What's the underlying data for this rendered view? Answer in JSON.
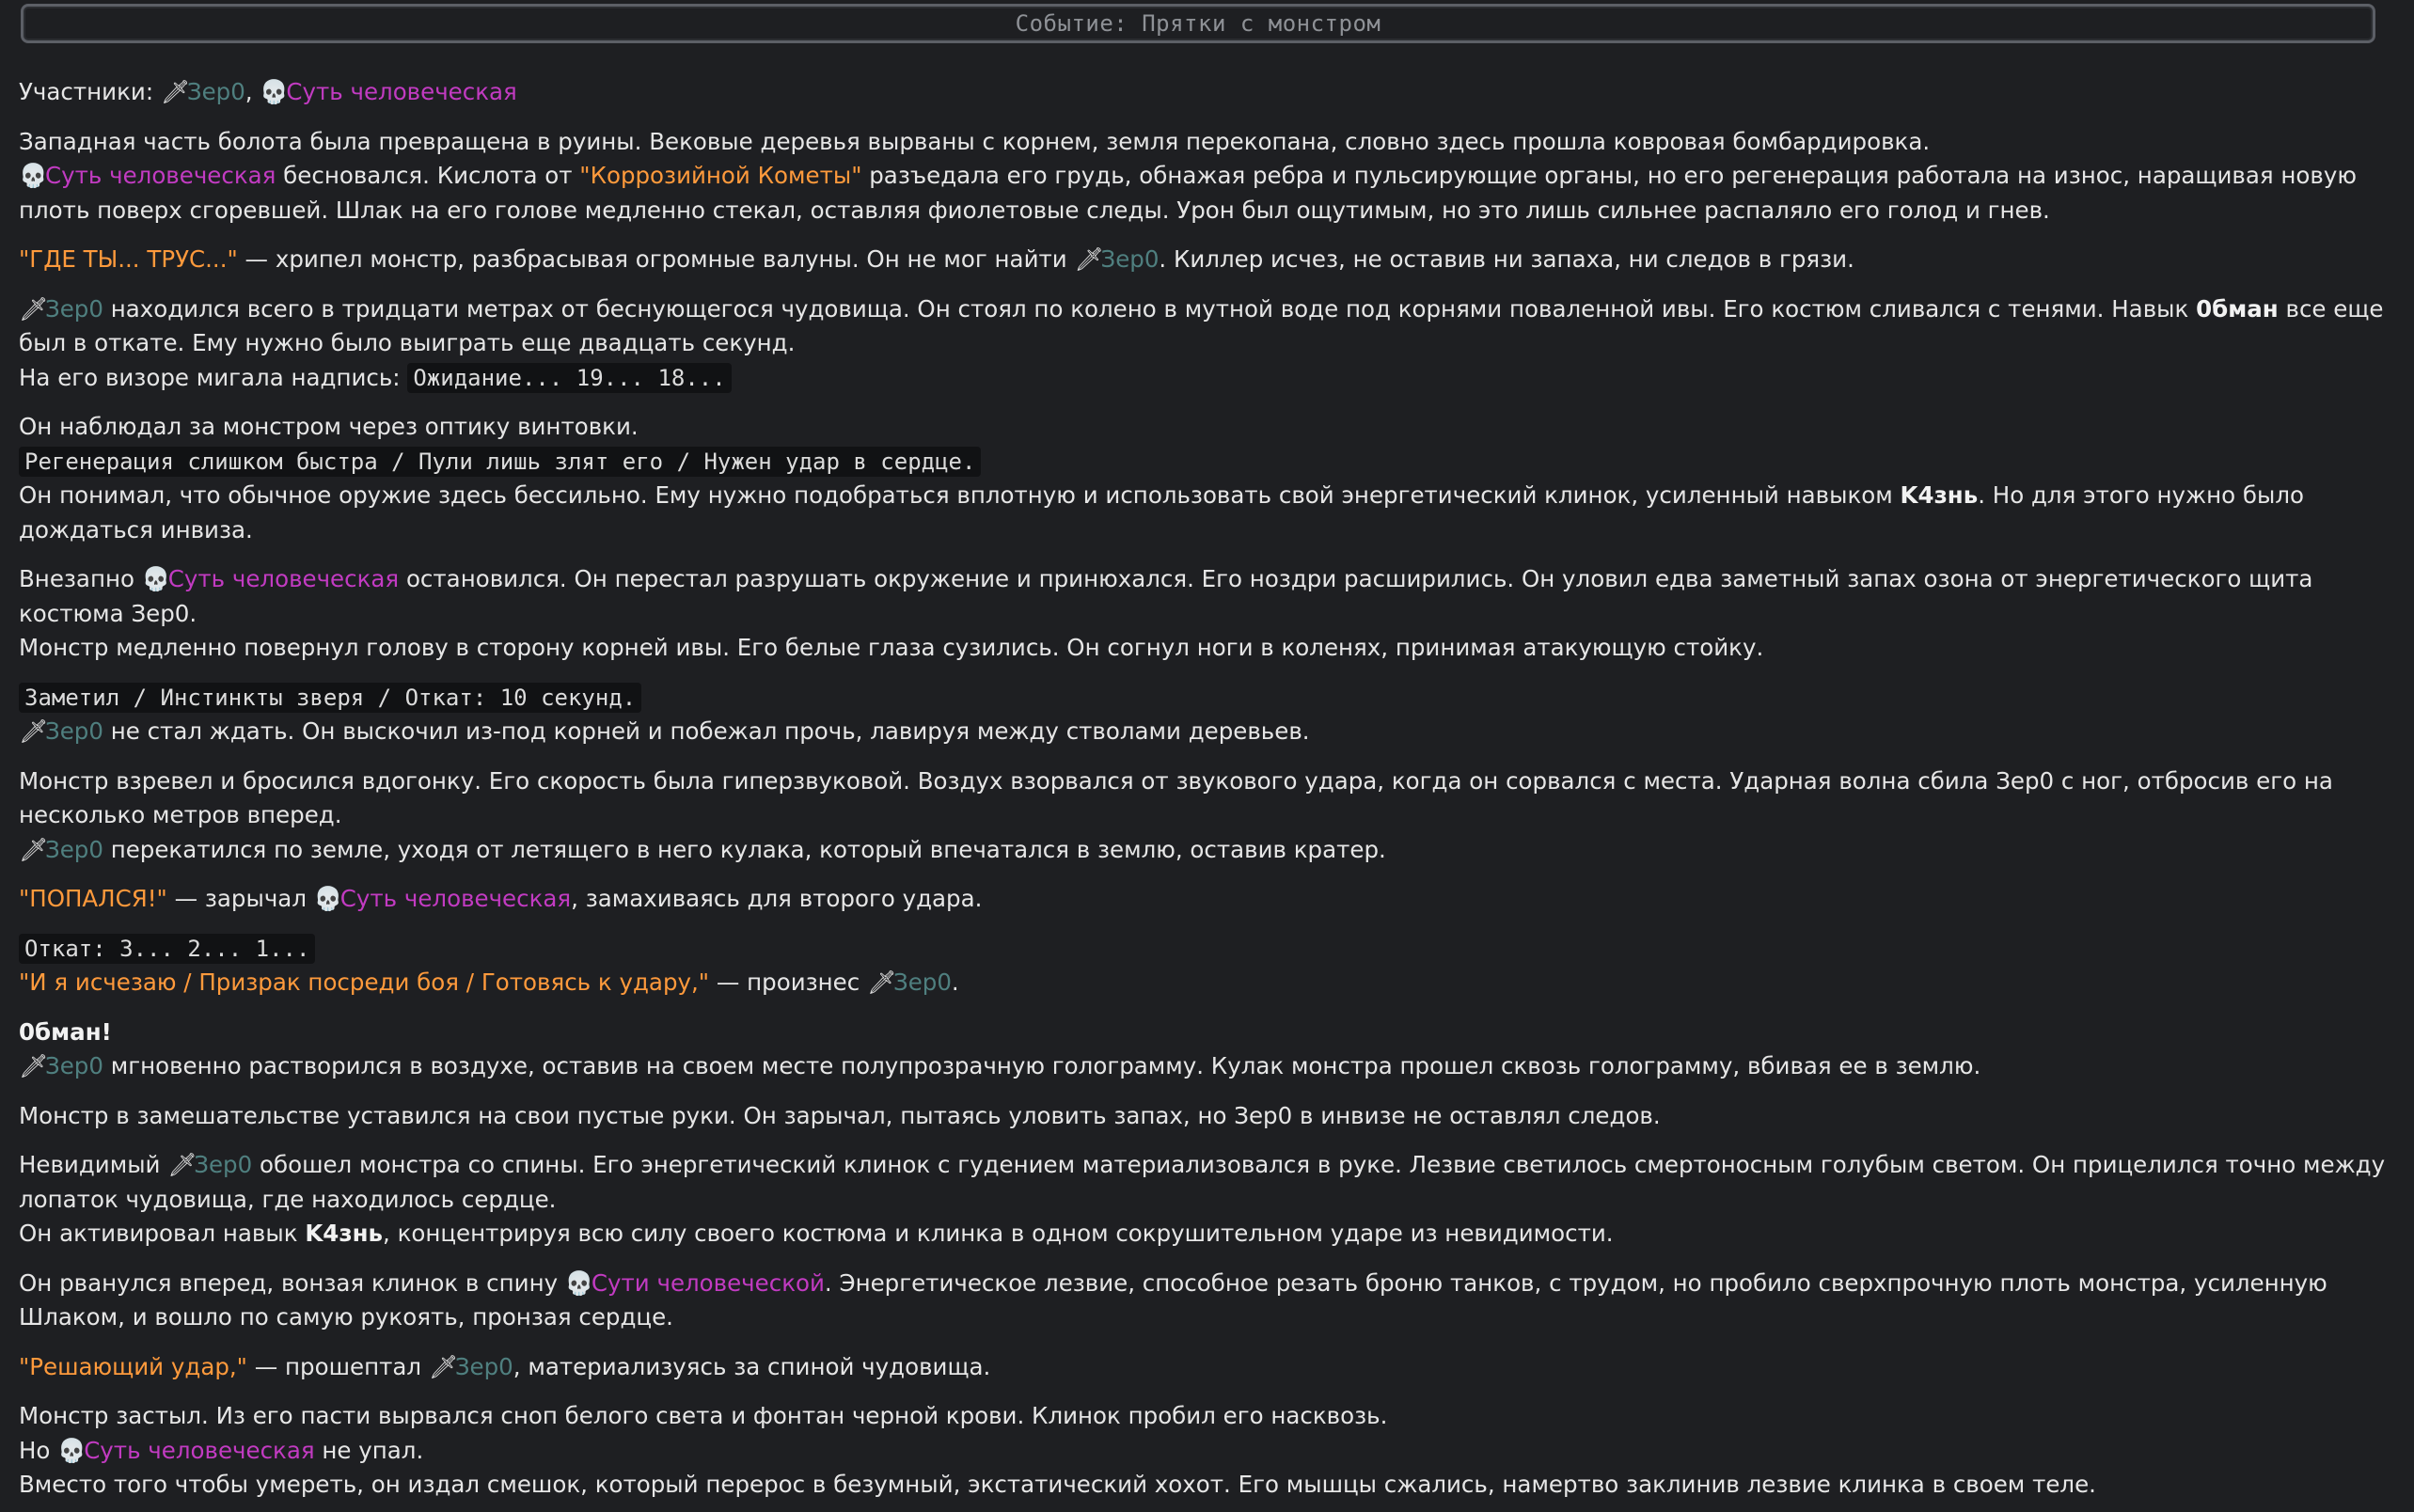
{
  "header": {
    "title": "Событие: Прятки с монстром"
  },
  "names": {
    "zero": "Зер0",
    "soul": "Суть человеческая",
    "soul_gen": "Сути человеческой"
  },
  "icons": {
    "zero": "dagger-icon",
    "soul": "skull-icon"
  },
  "colors": {
    "zero_name": "#4f7f7f",
    "soul_name": "#c23bc2",
    "quote": "#ff9a3c",
    "background": "#1e1f22"
  },
  "text": {
    "participants_label": "Участники:",
    "p1": "Западная часть болота была превращена в руины. Вековые деревья вырваны с корнем, земля перекопана, словно здесь прошла ковровая бомбардировка.",
    "p2_a": " бесновался. Кислота от ",
    "p2_quote": "\"Коррозийной Кометы\"",
    "p2_b": " разъедала его грудь, обнажая ребра и пульсирующие органы, но его регенерация работала на износ, наращивая новую плоть поверх сгоревшей. Шлак на его голове медленно стекал, оставляя фиолетовые следы. Урон был ощутимым, но это лишь сильнее распаляло его голод и гнев.",
    "p3_quote": "\"ГДЕ ТЫ... ТРУС...\"",
    "p3_a": " — хрипел монстр, разбрасывая огромные валуны. Он не мог найти ",
    "p3_b": ". Киллер исчез, не оставив ни запаха, ни следов в грязи.",
    "p4_a": " находился всего в тридцати метрах от беснующегося чудовища. Он стоял по колено в мутной воде под корнями поваленной ивы. Его костюм сливался с тенями. Навык ",
    "p4_bold": "0бман",
    "p4_b": " все еще был в откате. Ему нужно было выиграть еще двадцать секунд.",
    "p4_c": "На его визоре мигала надпись: ",
    "p4_code": "Ожидание... 19... 18...",
    "p5_a": "Он наблюдал за монстром через оптику винтовки.",
    "p5_code": "Регенерация слишком быстра / Пули лишь злят его / Нужен удар в сердце.",
    "p5_b": "Он понимал, что обычное оружие здесь бессильно. Ему нужно подобраться вплотную и использовать свой энергетический клинок, усиленный навыком ",
    "p5_bold": "K4знь",
    "p5_c": ". Но для этого нужно было дождаться инвиза.",
    "p6_a": "Внезапно ",
    "p6_b": " остановился. Он перестал разрушать окружение и принюхался. Его ноздри расширились. Он уловил едва заметный запах озона от энергетического щита костюма Зер0.",
    "p6_c": "Монстр медленно повернул голову в сторону корней ивы. Его белые глаза сузились. Он согнул ноги в коленях, принимая атакующую стойку.",
    "p7_code": "Заметил / Инстинкты зверя / Откат: 10 секунд.",
    "p7_a": " не стал ждать. Он выскочил из-под корней и побежал прочь, лавируя между стволами деревьев.",
    "p8_a": "Монстр взревел и бросился вдогонку. Его скорость была гиперзвуковой. Воздух взорвался от звукового удара, когда он сорвался с места. Ударная волна сбила Зер0 с ног, отбросив его на несколько метров вперед.",
    "p8_b": " перекатился по земле, уходя от летящего в него кулака, который впечатался в землю, оставив кратер.",
    "p9_quote": "\"ПОПАЛСЯ!\"",
    "p9_a": " — зарычал ",
    "p9_b": ", замахиваясь для второго удара.",
    "p10_code": "Откат: 3... 2... 1...",
    "p10_quote": "\"И я исчезаю / Призрак посреди боя / Готовясь к удару,\"",
    "p10_a": " — произнес ",
    "p10_b": ".",
    "p11_bold": "0бман!",
    "p11_a": " мгновенно растворился в воздухе, оставив на своем месте полупрозрачную голограмму. Кулак монстра прошел сквозь голограмму, вбивая ее в землю.",
    "p12": "Монстр в замешательстве уставился на свои пустые руки. Он зарычал, пытаясь уловить запах, но Зер0 в инвизе не оставлял следов.",
    "p13_a": "Невидимый ",
    "p13_b": " обошел монстра со спины. Его энергетический клинок с гудением материализовался в руке. Лезвие светилось смертоносным голубым светом. Он прицелился точно между лопаток чудовища, где находилось сердце.",
    "p13_c": "Он активировал навык ",
    "p13_bold": "K4знь",
    "p13_d": ", концентрируя всю силу своего костюма и клинка в одном сокрушительном ударе из невидимости.",
    "p14_a": "Он рванулся вперед, вонзая клинок в спину ",
    "p14_b": ". Энергетическое лезвие, способное резать броню танков, с трудом, но пробило сверхпрочную плоть монстра, усиленную Шлаком, и вошло по самую рукоять, пронзая сердце.",
    "p15_quote": "\"Решающий удар,\"",
    "p15_a": " — прошептал ",
    "p15_b": ", материализуясь за спиной чудовища.",
    "p16_a": "Монстр застыл. Из его пасти вырвался сноп белого света и фонтан черной крови. Клинок пробил его насквозь.",
    "p16_b": "Но ",
    "p16_c": " не упал.",
    "p16_d": "Вместо того чтобы умереть, он издал смешок, который перерос в безумный, экстатический хохот. Его мышцы сжались, намертво заклинив лезвие клинка в своем теле."
  }
}
